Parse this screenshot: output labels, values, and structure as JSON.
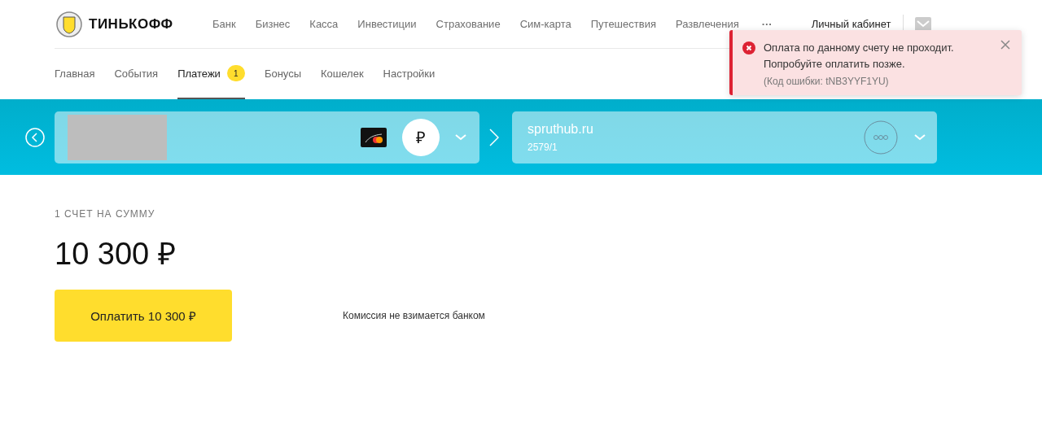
{
  "header": {
    "brand": "ТИНЬКОФФ",
    "nav": [
      "Банк",
      "Бизнес",
      "Касса",
      "Инвестиции",
      "Страхование",
      "Сим-карта",
      "Путешествия",
      "Развлечения"
    ],
    "more": "···",
    "account": "Личный кабинет"
  },
  "tabs": [
    {
      "label": "Главная",
      "selected": false
    },
    {
      "label": "События",
      "selected": false
    },
    {
      "label": "Платежи",
      "selected": true,
      "badge": "1"
    },
    {
      "label": "Бонусы",
      "selected": false
    },
    {
      "label": "Кошелек",
      "selected": false
    },
    {
      "label": "Настройки",
      "selected": false
    }
  ],
  "source": {
    "currency": "₽"
  },
  "target": {
    "name": "spruthub.ru",
    "number": "2579/1"
  },
  "summary": {
    "caption": "1 СЧЕТ НА СУММУ",
    "amount": "10 300 ₽",
    "pay_button": "Оплатить 10 300 ₽",
    "note": "Комиссия не взимается банком"
  },
  "toast": {
    "message": "Оплата по данному счету не проходит.\nПопробуйте оплатить позже.",
    "code": "(Код ошибки: tNB3YYF1YU)"
  }
}
